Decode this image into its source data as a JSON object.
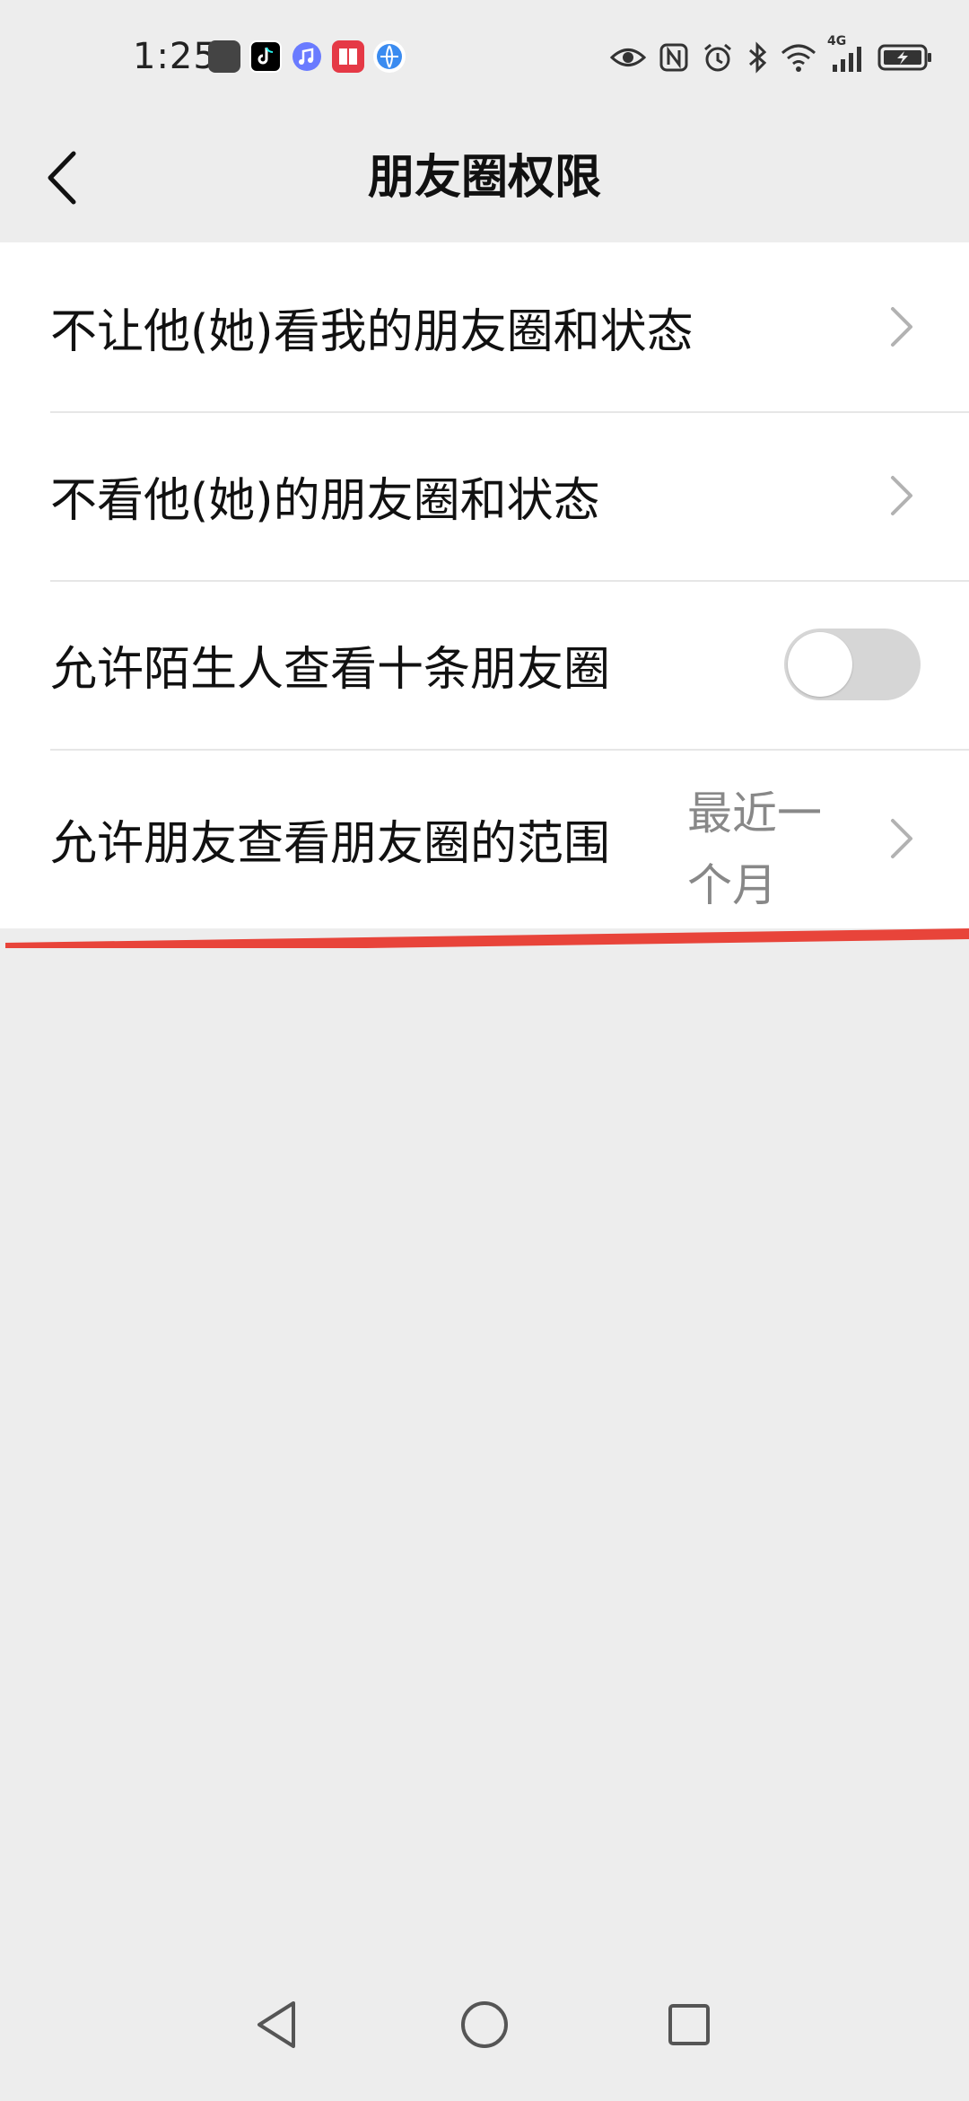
{
  "status_bar": {
    "time": "1:25",
    "notification_icons": [
      "huawei-appgallery-icon",
      "tiktok-icon",
      "music-icon",
      "book-icon",
      "browser-icon"
    ],
    "system_icons": [
      "eye-icon",
      "nfc-icon",
      "alarm-icon",
      "bluetooth-icon",
      "wifi-icon",
      "signal-4g-icon",
      "battery-charging-icon"
    ],
    "network_label": "4G"
  },
  "header": {
    "title": "朋友圈权限"
  },
  "settings": {
    "items": [
      {
        "label": "不让他(她)看我的朋友圈和状态",
        "control": "chevron"
      },
      {
        "label": "不看他(她)的朋友圈和状态",
        "control": "chevron"
      },
      {
        "label": "允许陌生人查看十条朋友圈",
        "control": "toggle",
        "enabled": false
      },
      {
        "label": "允许朋友查看朋友圈的范围",
        "value": "最近一个月",
        "control": "chevron"
      }
    ]
  },
  "colors": {
    "background": "#ededed",
    "list_background": "#ffffff",
    "annotation_red": "#e8443a",
    "toggle_off": "#d6d6d6",
    "secondary_text": "#888888"
  },
  "nav_bar": {
    "buttons": [
      "back-triangle-icon",
      "home-circle-icon",
      "recents-square-icon"
    ]
  }
}
